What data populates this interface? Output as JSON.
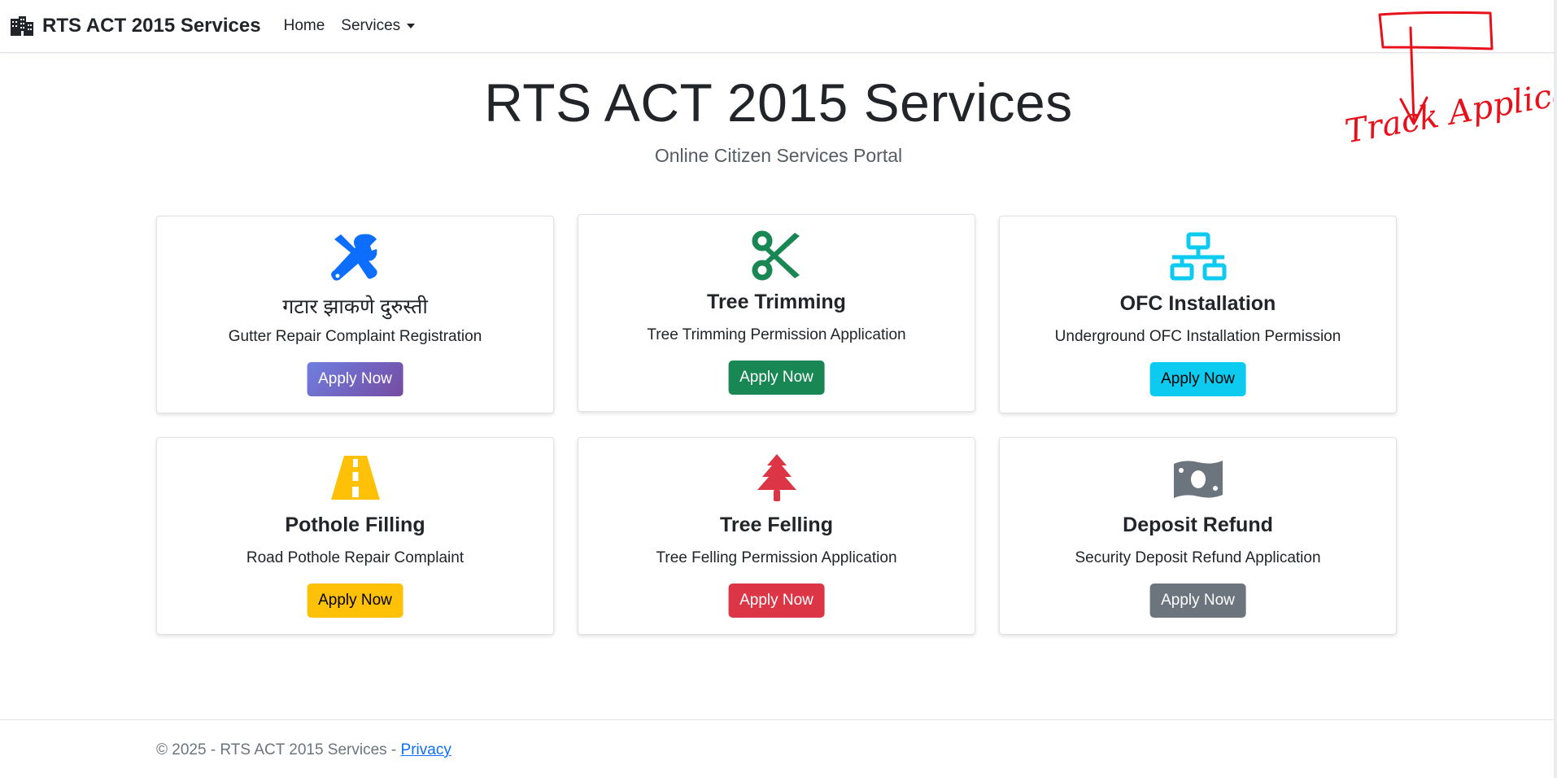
{
  "navbar": {
    "brand": "RTS ACT 2015 Services",
    "brand_icon": "building-icon",
    "links": [
      {
        "label": "Home"
      },
      {
        "label": "Services"
      }
    ]
  },
  "hero": {
    "title": "RTS ACT 2015 Services",
    "subtitle": "Online Citizen Services Portal"
  },
  "services": [
    {
      "title": "गटार झाकणे दुरुस्ती",
      "desc": "Gutter Repair Complaint Registration",
      "button": "Apply Now",
      "icon": "tools-icon",
      "icon_color": "#0d6efd",
      "button_color": "linear-gradient(135deg,#6f7fe0,#764ba2)",
      "button_text_color": "#ffffff"
    },
    {
      "title": "Tree Trimming",
      "desc": "Tree Trimming Permission Application",
      "button": "Apply Now",
      "icon": "scissors-icon",
      "icon_color": "#198754",
      "button_color": "#198754",
      "button_text_color": "#ffffff"
    },
    {
      "title": "OFC Installation",
      "desc": "Underground OFC Installation Permission",
      "button": "Apply Now",
      "icon": "network-icon",
      "icon_color": "#0dcaf0",
      "button_color": "#0dcaf0",
      "button_text_color": "#000000"
    },
    {
      "title": "Pothole Filling",
      "desc": "Road Pothole Repair Complaint",
      "button": "Apply Now",
      "icon": "road-icon",
      "icon_color": "#ffc107",
      "button_color": "#ffc107",
      "button_text_color": "#000000"
    },
    {
      "title": "Tree Felling",
      "desc": "Tree Felling Permission Application",
      "button": "Apply Now",
      "icon": "tree-icon",
      "icon_color": "#dc3545",
      "button_color": "#dc3545",
      "button_text_color": "#ffffff"
    },
    {
      "title": "Deposit Refund",
      "desc": "Security Deposit Refund Application",
      "button": "Apply Now",
      "icon": "money-icon",
      "icon_color": "#6c757d",
      "button_color": "#6c757d",
      "button_text_color": "#ffffff"
    }
  ],
  "footer": {
    "text": "© 2025 - RTS ACT 2015 Services - ",
    "link": "Privacy"
  },
  "annotation": {
    "text": "Track Applicatio"
  }
}
